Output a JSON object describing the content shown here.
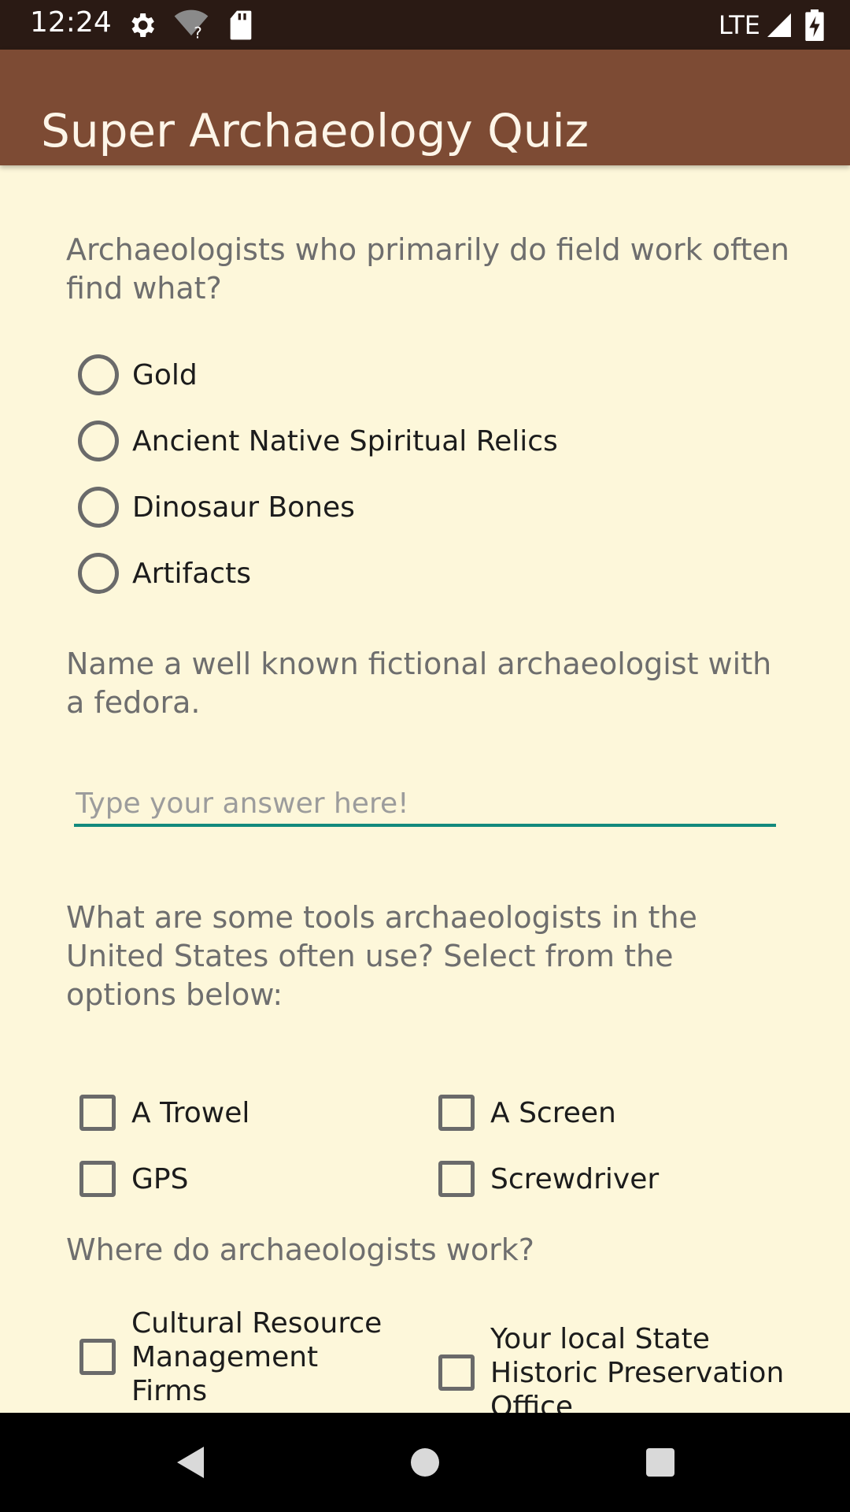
{
  "status_bar": {
    "time": "12:24",
    "network": "LTE",
    "icons": [
      "settings-icon",
      "wifi-unknown-icon",
      "sd-card-icon",
      "signal-icon",
      "battery-charging-icon"
    ]
  },
  "app_bar": {
    "title": "Super Archaeology Quiz"
  },
  "colors": {
    "app_bar": "#7d4b34",
    "background": "#fdf7da",
    "accent": "#138a7d",
    "status_bar": "#2a1a14"
  },
  "quiz": {
    "q1": {
      "text": "Archaeologists who primarily do field work often find what?",
      "options": [
        "Gold",
        "Ancient Native Spiritual Relics",
        "Dinosaur Bones",
        "Artifacts"
      ]
    },
    "q2": {
      "text": "Name a well known fictional archaeologist with a fedora.",
      "placeholder": "Type your answer here!",
      "value": ""
    },
    "q3": {
      "text": "What are some tools archaeologists in the United States often use? Select from the options below:",
      "options": [
        "A Trowel",
        "A Screen",
        "GPS",
        "Screwdriver"
      ]
    },
    "q4": {
      "text": "Where do archaeologists work?",
      "options": [
        "Cultural Resource Management Firms",
        "Your local State Historic Preservation Office"
      ]
    }
  },
  "nav_bar": {
    "buttons": [
      "back-icon",
      "home-icon",
      "recents-icon"
    ]
  }
}
